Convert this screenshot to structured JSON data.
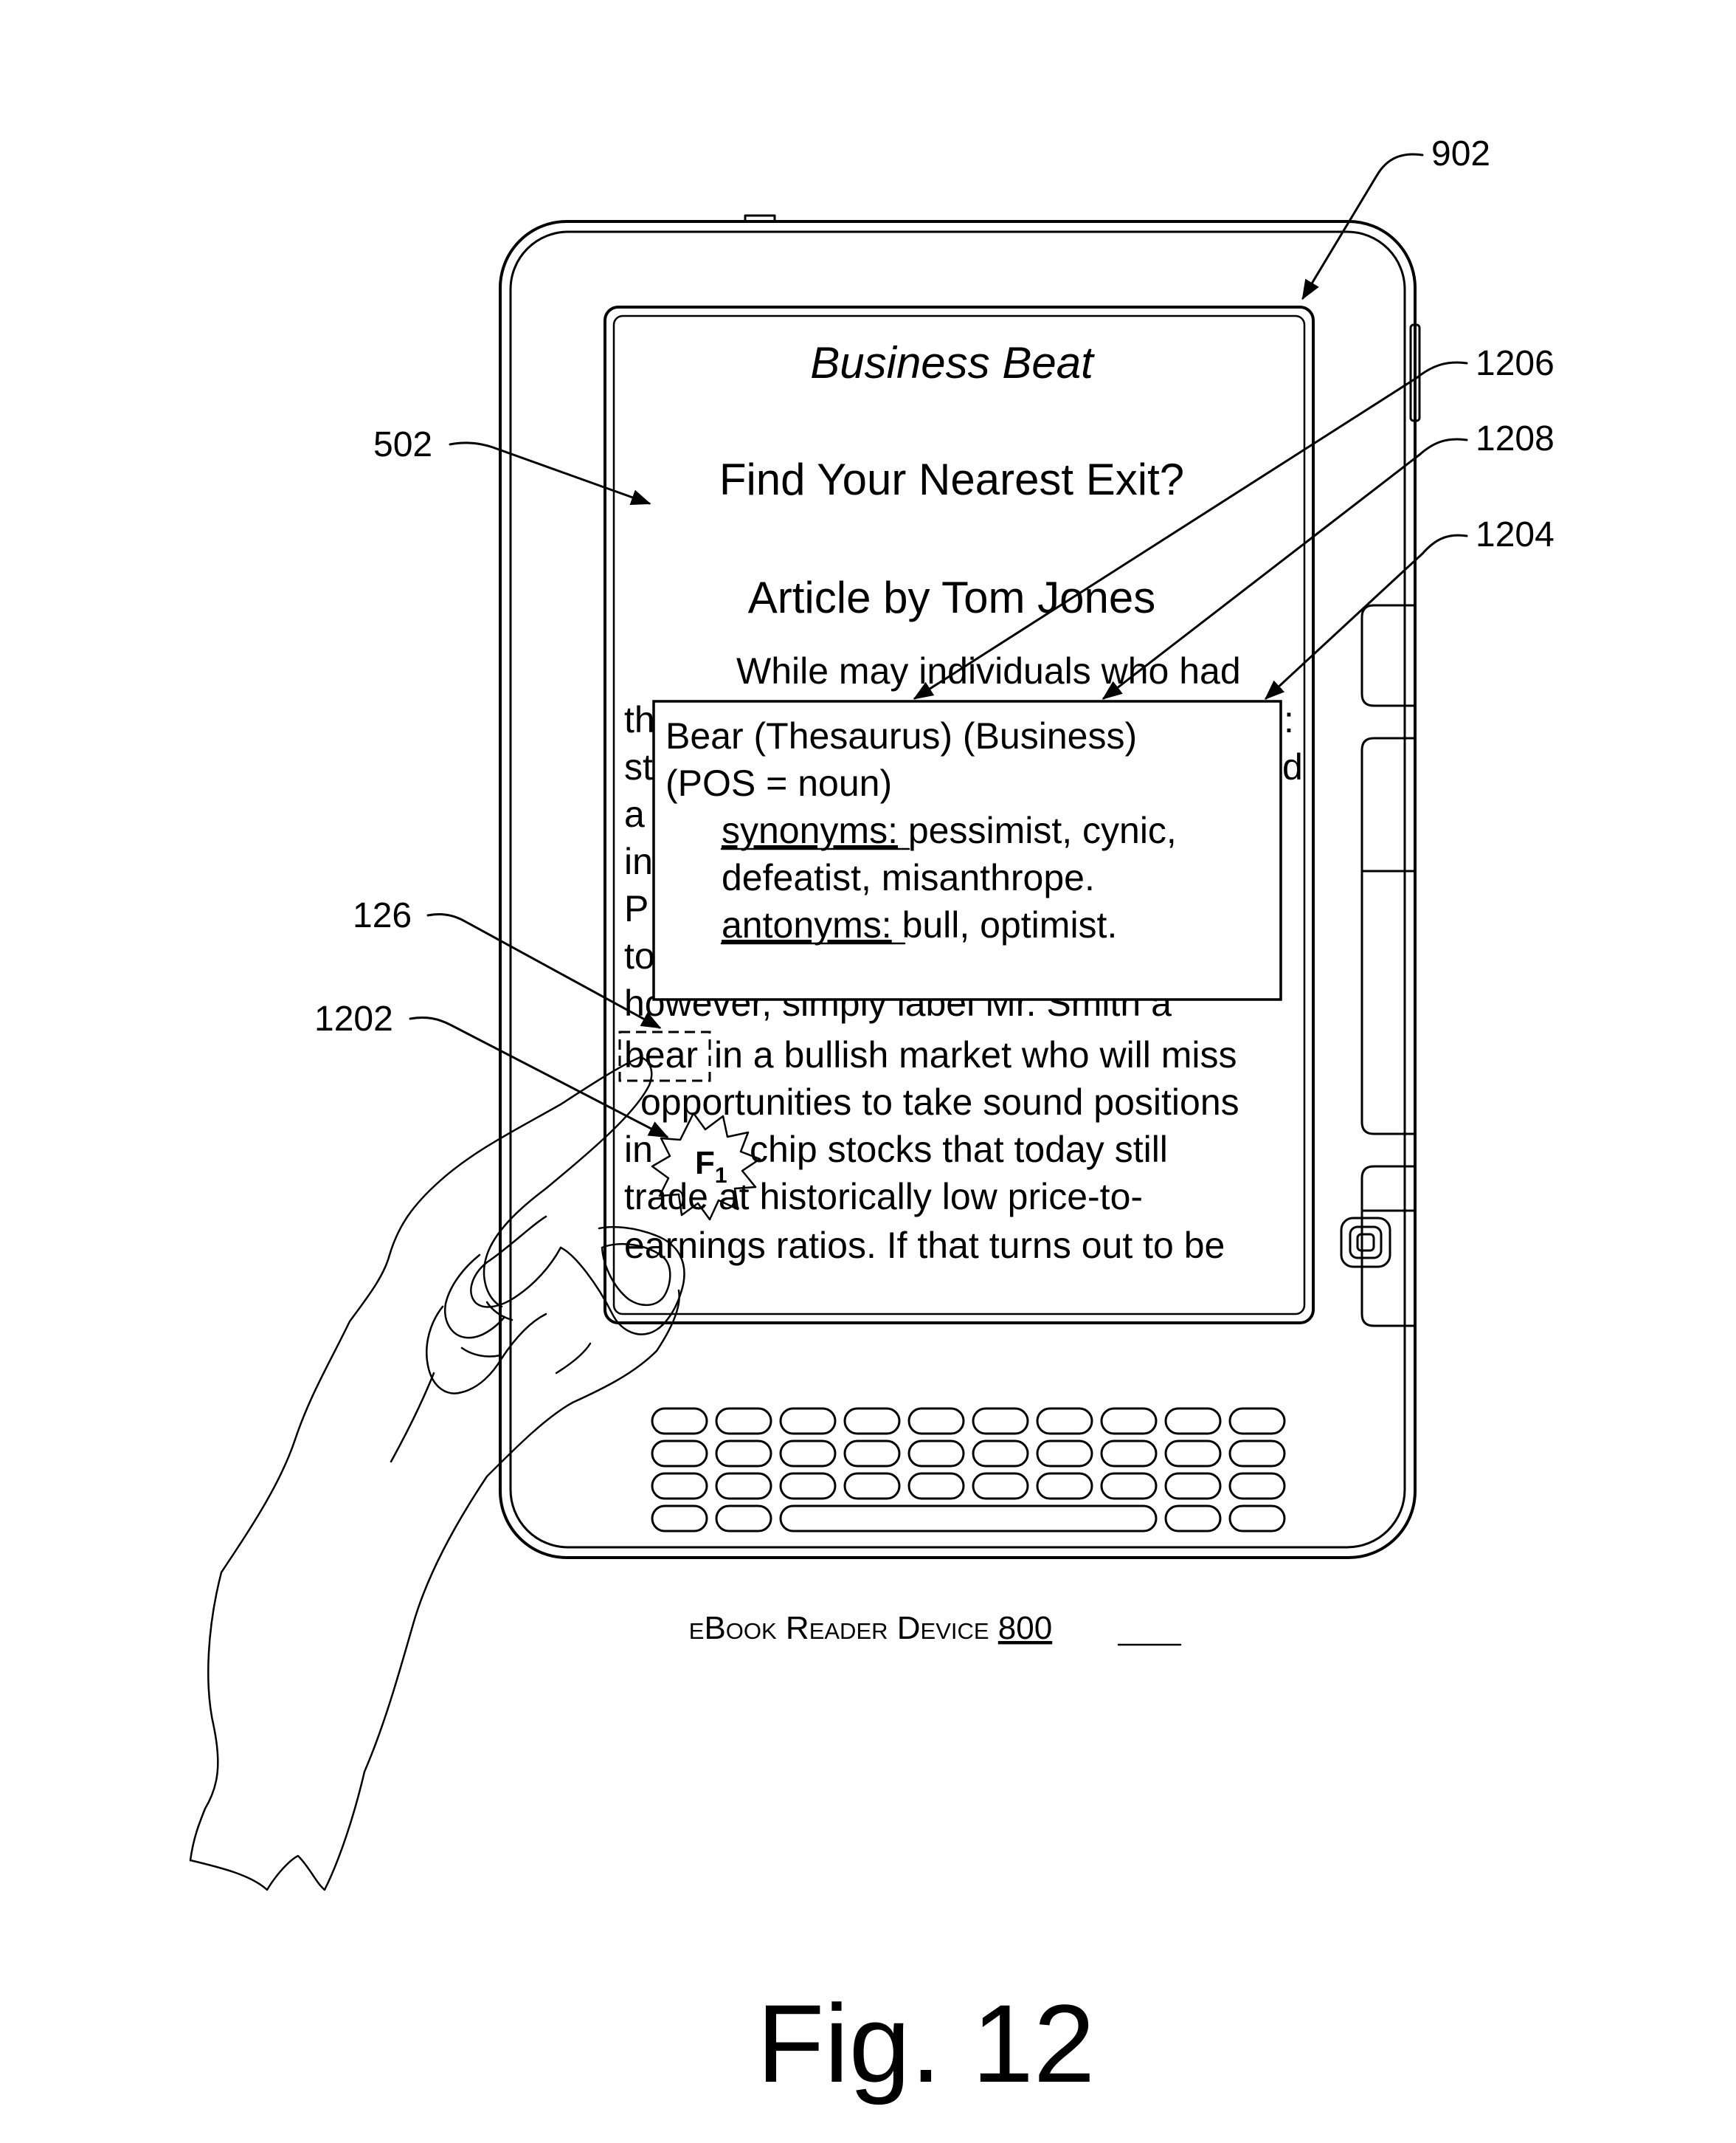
{
  "refs": {
    "screen": "902",
    "popup_title": "1206",
    "popup_category": "1208",
    "popup_box": "1204",
    "text_area": "502",
    "finger": "126",
    "selected_word": "1202"
  },
  "screen": {
    "header": "Business Beat",
    "title": "Find Your Nearest Exit?",
    "byline": "Article by Tom Jones",
    "lines": [
      "While may individuals who had",
      "th",
      "st",
      "a",
      "in",
      "P",
      "to",
      "however, simply label Mr.  Smith a",
      "in a bullish market who will miss",
      "opportunities to take sound positions",
      "in",
      "chip stocks that today still",
      "trade at historically low price-to-",
      "earnings ratios.  If that turns out to be"
    ],
    "right_fragments": [
      ":",
      "d"
    ],
    "selected_word": "bear"
  },
  "popup": {
    "title": "Bear (Thesaurus) (Business)",
    "pos": "(POS = noun)",
    "synonyms_label": "synonyms:",
    "synonyms": " pessimist, cynic,",
    "synonyms_cont": "defeatist, misanthrope.",
    "antonyms_label": "antonyms:",
    "antonyms": " bull, optimist."
  },
  "touch": {
    "label": "F",
    "subscript": "1"
  },
  "caption": {
    "text": "eBook Reader Device",
    "number": "800"
  },
  "figure": "Fig. 12"
}
